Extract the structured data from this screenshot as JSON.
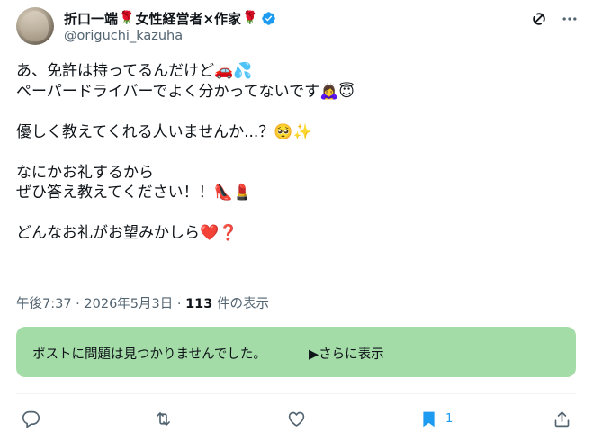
{
  "author": {
    "name_prefix": "折口一端",
    "rose_1": "🌹",
    "name_suffix": "女性経営者×作家",
    "rose_2": "🌹",
    "handle": "@origuchi_kazuha"
  },
  "tweet": {
    "lines": [
      "あ、免許は持ってるんだけど🚗💦",
      "ペーパードライバーでよく分かってないです🙇‍♀️😇",
      "",
      "優しく教えてくれる人いませんか...？🥺✨",
      "",
      "なにかお礼するから",
      "ぜひ答え教えてください！！👠💄",
      "",
      "どんなお礼がお望みかしら❤️❓"
    ]
  },
  "meta": {
    "time": "午後7:37",
    "separator": " · ",
    "date": "2026年5月3日",
    "views_count": "113",
    "views_label": " 件の表示"
  },
  "note": {
    "text": "ポストに問題は見つかりませんでした。",
    "more": "▶さらに表示"
  },
  "actions": {
    "bookmark_count": "1"
  },
  "colors": {
    "accent": "#1d9bf0",
    "note_bg": "#a3dca7",
    "secondary_text": "#536471"
  },
  "icons": [
    "verified-icon",
    "grok-icon",
    "more-icon",
    "reply-icon",
    "retweet-icon",
    "like-icon",
    "bookmark-icon",
    "share-icon"
  ]
}
